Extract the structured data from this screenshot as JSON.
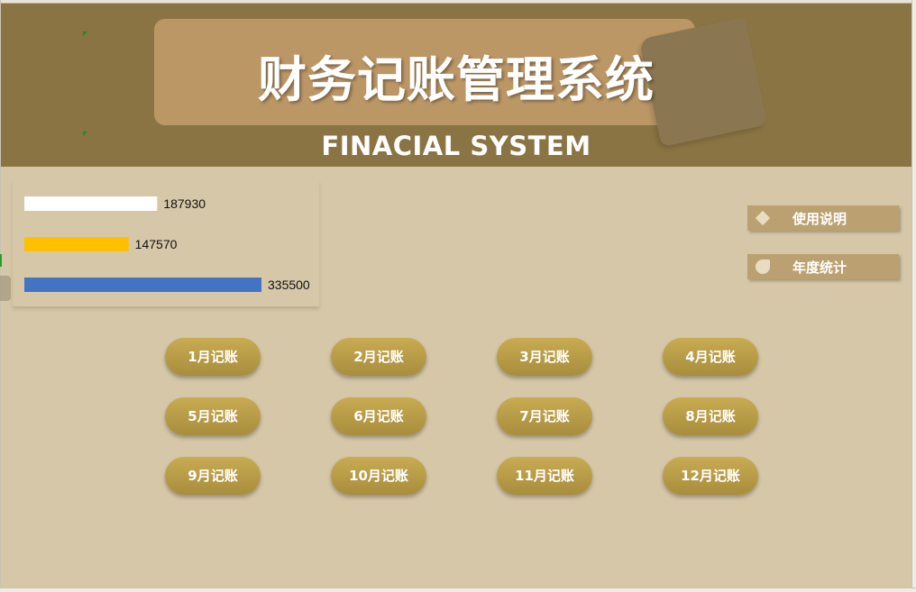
{
  "header": {
    "title": "财务记账管理系统",
    "subtitle": "FINACIAL SYSTEM"
  },
  "colors": {
    "header_bg": "#8b7444",
    "banner": "#bc9766",
    "page_bg": "#d6c7a8",
    "month_button": "#b89a48"
  },
  "chart_data": {
    "type": "bar",
    "orientation": "horizontal",
    "values": [
      187930,
      147570,
      335500
    ],
    "data_labels": [
      "187930",
      "147570",
      "335500"
    ],
    "colors": [
      "#ffffff",
      "#ffc000",
      "#4472c4"
    ],
    "xlim": [
      0,
      335500
    ]
  },
  "side_menu": {
    "usage": {
      "label": "使用说明",
      "icon": "diamond-icon"
    },
    "annual": {
      "label": "年度统计",
      "icon": "leaf-icon"
    }
  },
  "months": [
    "1月记账",
    "2月记账",
    "3月记账",
    "4月记账",
    "5月记账",
    "6月记账",
    "7月记账",
    "8月记账",
    "9月记账",
    "10月记账",
    "11月记账",
    "12月记账"
  ]
}
